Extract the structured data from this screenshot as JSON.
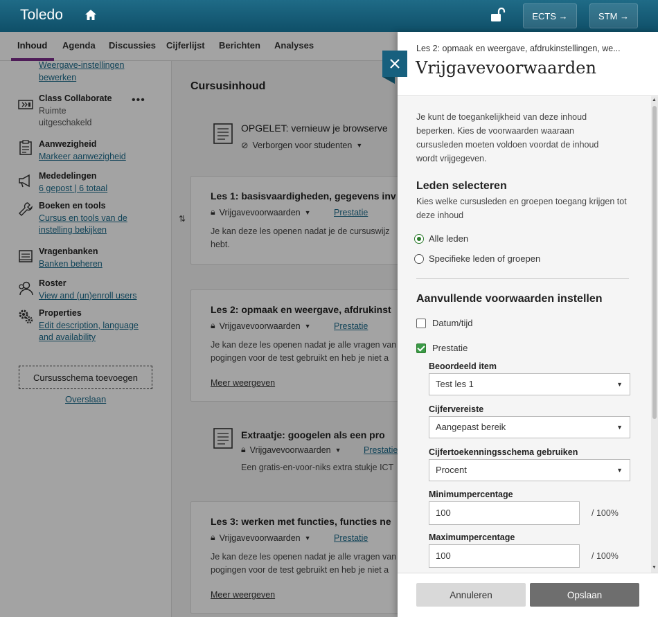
{
  "header": {
    "brand": "Toledo",
    "courses": [
      "ECTS →",
      "STM →"
    ]
  },
  "tabs": [
    "Inhoud",
    "Agenda",
    "Discussies",
    "Cijferlijst",
    "Berichten",
    "Analyses"
  ],
  "sidebar": {
    "items": [
      {
        "title": "",
        "lines": [
          "Weergave-instellingen",
          "bewerken"
        ],
        "icon": "settings-edit-icon"
      },
      {
        "title": "Class Collaborate",
        "lines": [
          "Ruimte",
          "uitgeschakeld"
        ],
        "icon": "video-icon"
      },
      {
        "title": "Aanwezigheid",
        "lines": [
          "Markeer aanwezigheid"
        ],
        "icon": "clipboard-icon"
      },
      {
        "title": "Mededelingen",
        "lines": [
          "6 gepost | 6 totaal"
        ],
        "icon": "megaphone-icon"
      },
      {
        "title": "Boeken en tools",
        "lines": [
          "Cursus en tools van de",
          "instelling bekijken"
        ],
        "icon": "wrench-icon"
      },
      {
        "title": "Vragenbanken",
        "lines": [
          "Banken beheren"
        ],
        "icon": "bank-icon"
      },
      {
        "title": "Roster",
        "lines": [
          "View and (un)enroll users"
        ],
        "icon": "users-icon"
      },
      {
        "title": "Properties",
        "lines": [
          "Edit description, language",
          "and availability"
        ],
        "icon": "gears-icon"
      }
    ],
    "more": "•••",
    "schema_button": "Cursusschema toevoegen",
    "skip": "Overslaan"
  },
  "main": {
    "title": "Cursusinhoud",
    "items": [
      {
        "title": "OPGELET: vernieuw je browserve",
        "meta": "Verborgen voor studenten",
        "link": "",
        "desc": [],
        "more": ""
      },
      {
        "title": "Les 1: basisvaardigheden, gegevens inv",
        "meta": "Vrijgavevoorwaarden",
        "link": "Prestatie",
        "desc": [
          "Je kan deze les openen nadat je de cursuswijz",
          "hebt."
        ],
        "more": ""
      },
      {
        "title": "Les 2: opmaak en weergave, afdrukinst",
        "meta": "Vrijgavevoorwaarden",
        "link": "Prestatie",
        "desc": [
          "Je kan deze les openen nadat je alle vragen van",
          "pogingen voor de test gebruikt en heb je niet a"
        ],
        "more": "Meer weergeven"
      },
      {
        "title": "Extraatje: googelen als een pro",
        "meta": "Vrijgavevoorwaarden",
        "link": "Prestatie",
        "desc": [
          "Een gratis-en-voor-niks extra stukje ICT"
        ],
        "more": ""
      },
      {
        "title": "Les 3: werken met functies, functies ne",
        "meta": "Vrijgavevoorwaarden",
        "link": "Prestatie",
        "desc": [
          "Je kan deze les openen nadat je alle vragen van",
          "pogingen voor de test gebruikt en heb je niet a"
        ],
        "more": "Meer weergeven"
      }
    ]
  },
  "panel": {
    "crumb": "Les 2: opmaak en weergave, afdrukinstellingen, we...",
    "title": "Vrijgavevoorwaarden",
    "intro": "Je kunt de toegankelijkheid van deze inhoud beperken. Kies de voorwaarden waaraan cursusleden moeten voldoen voordat de inhoud wordt vrijgegeven.",
    "members": {
      "title": "Leden selecteren",
      "subtitle": "Kies welke cursusleden en groepen toegang krijgen tot deze inhoud",
      "options": [
        {
          "label": "Alle leden",
          "selected": true
        },
        {
          "label": "Specifieke leden of groepen",
          "selected": false
        }
      ]
    },
    "extra": {
      "title": "Aanvullende voorwaarden instellen",
      "datetime_label": "Datum/tijd",
      "datetime_checked": false,
      "performance_label": "Prestatie",
      "performance_checked": true,
      "graded_item_label": "Beoordeeld item",
      "graded_item_value": "Test les 1",
      "grade_req_label": "Cijfervereiste",
      "grade_req_value": "Aangepast bereik",
      "schema_label": "Cijfertoekenningsschema gebruiken",
      "schema_value": "Procent",
      "min_label": "Minimumpercentage",
      "min_value": "100",
      "max_label": "Maximumpercentage",
      "max_value": "100",
      "suffix": "/ 100%"
    },
    "cancel": "Annuleren",
    "save": "Opslaan"
  },
  "colors": {
    "header": "#17607e",
    "accent_tab": "#7b2c8a",
    "link": "#1a6a8a",
    "check": "#3a9a47"
  }
}
